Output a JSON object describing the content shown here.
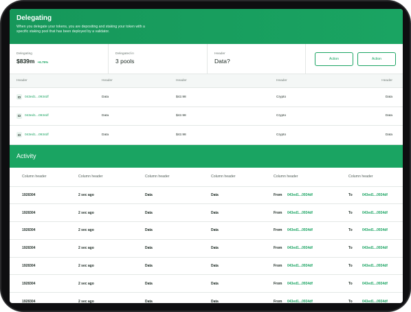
{
  "delegating": {
    "title": "Delegating",
    "description": "When you delegate your tokens, you are depositing and staking your token with a specific staking pool that has been deployed by a validator."
  },
  "stats": [
    {
      "label": "Delegating",
      "value": "$839m",
      "delta": "+6.75%"
    },
    {
      "label": "Delegated in",
      "value": "3 pools"
    },
    {
      "label": "Header",
      "value": "Data?"
    }
  ],
  "actions": [
    "Action",
    "Action"
  ],
  "pools_table": {
    "headers": [
      "Header",
      "Header",
      "Header",
      "Header",
      "Header"
    ],
    "rows": [
      [
        "043ed1...0934df",
        "Data",
        "$42.98",
        "Crypto",
        "Data"
      ],
      [
        "043ed1...0934df",
        "Data",
        "$42.98",
        "Crypto",
        "Data"
      ],
      [
        "043ed1...0934df",
        "Data",
        "$42.98",
        "Crypto",
        "Data"
      ]
    ]
  },
  "activity": {
    "title": "Activity",
    "headers": [
      "Column header",
      "Column header",
      "Column header",
      "Column header",
      "Column header",
      "Column header"
    ],
    "from_label": "From",
    "to_label": "To",
    "rows": [
      [
        "1928304",
        "2 sec ago",
        "Data",
        "Data",
        "043ed1...0934df",
        "043ed1...0934df"
      ],
      [
        "1928304",
        "2 sec ago",
        "Data",
        "Data",
        "043ed1...0934df",
        "043ed1...0934df"
      ],
      [
        "1928304",
        "2 sec ago",
        "Data",
        "Data",
        "043ed1...0934df",
        "043ed1...0934df"
      ],
      [
        "1928304",
        "2 sec ago",
        "Data",
        "Data",
        "043ed1...0934df",
        "043ed1...0934df"
      ],
      [
        "1928304",
        "2 sec ago",
        "Data",
        "Data",
        "043ed1...0934df",
        "043ed1...0934df"
      ],
      [
        "1928304",
        "2 sec ago",
        "Data",
        "Data",
        "043ed1...0934df",
        "043ed1...0934df"
      ],
      [
        "1928304",
        "2 sec ago",
        "Data",
        "Data",
        "043ed1...0934df",
        "043ed1...0934df"
      ]
    ]
  },
  "colors": {
    "brand": "#1aa462",
    "text": "#1c2a23",
    "muted": "#6f7b75"
  }
}
